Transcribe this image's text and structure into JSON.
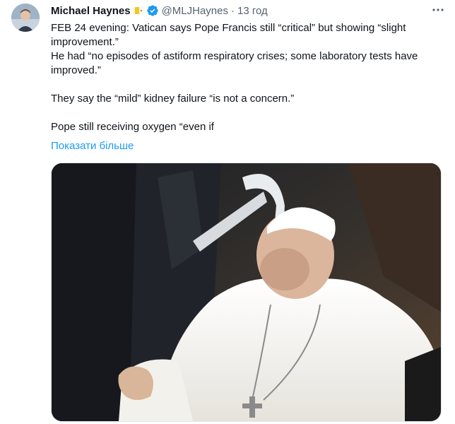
{
  "tweet": {
    "author_name": "Michael Haynes",
    "handle": "@MLJHaynes",
    "separator": "·",
    "time": "13 год",
    "more_icon": "more-horizontal-icon",
    "lines": [
      "FEB 24 evening: Vatican says Pope Francis still “critical” but showing “slight improvement.”",
      "He had “no episodes of astiform respiratory crises; some laboratory tests have improved.”",
      "",
      "They say the “mild” kidney failure “is not a concern.”",
      "",
      "Pope still receiving oxygen “even if"
    ],
    "show_more": "Показати більше"
  },
  "colors": {
    "link": "#1d9bf0",
    "verified": "#1d9bf0",
    "secondary_text": "#536471"
  }
}
